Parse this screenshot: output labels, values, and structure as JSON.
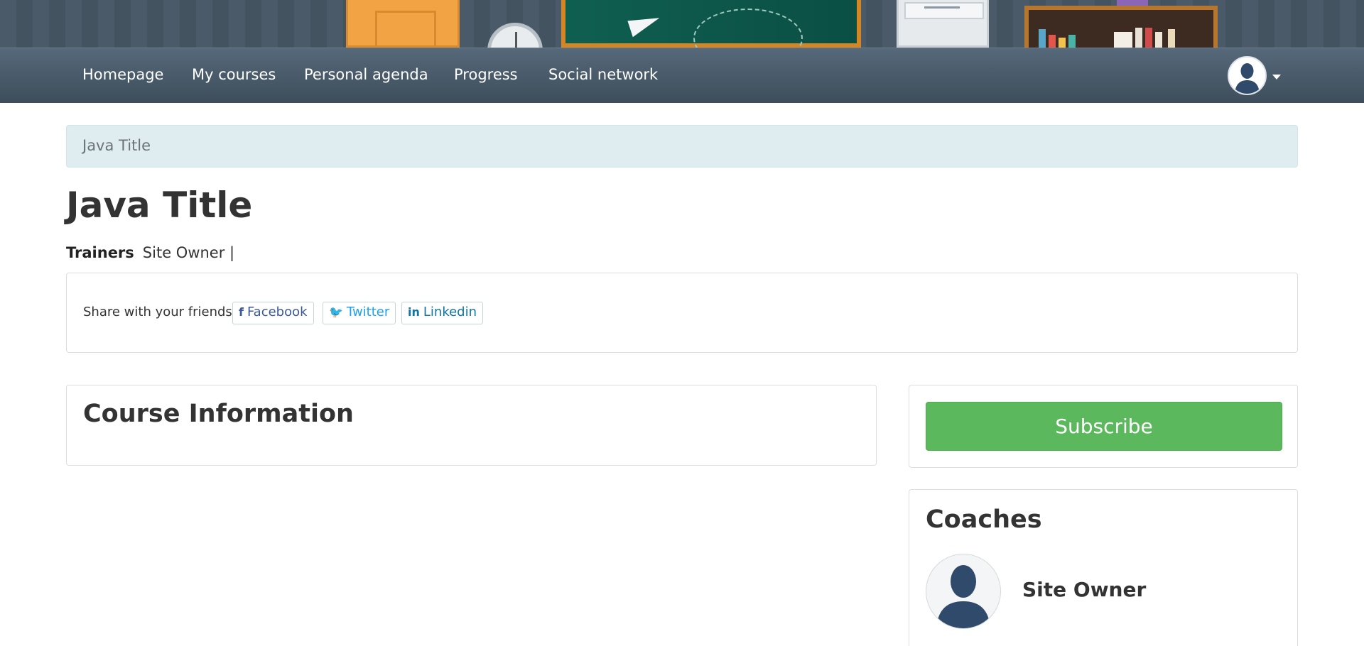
{
  "nav": {
    "items": [
      "Homepage",
      "My courses",
      "Personal agenda",
      "Progress",
      "Social network"
    ],
    "user_avatar_icon": "user-silhouette-icon",
    "caret_icon": "caret-down-icon"
  },
  "breadcrumb": {
    "current": "Java Title"
  },
  "page": {
    "title": "Java Title"
  },
  "trainers": {
    "label": "Trainers",
    "value": "Site Owner |"
  },
  "share": {
    "label": "Share with your friends",
    "facebook": {
      "icon": "f",
      "label": "Facebook"
    },
    "twitter": {
      "icon": "🐦",
      "label": "Twitter"
    },
    "linkedin": {
      "icon": "in",
      "label": "Linkedin"
    }
  },
  "course_info": {
    "heading": "Course Information"
  },
  "subscribe": {
    "label": "Subscribe"
  },
  "coaches": {
    "heading": "Coaches",
    "name": "Site Owner"
  },
  "colors": {
    "nav_bg": "#4a5b6a",
    "breadcrumb_bg": "#dfedf0",
    "subscribe_bg": "#5cb85c",
    "facebook": "#3b5998",
    "twitter": "#1da1f2",
    "linkedin": "#0e76a8",
    "avatar_silhouette": "#2f4a6b"
  }
}
